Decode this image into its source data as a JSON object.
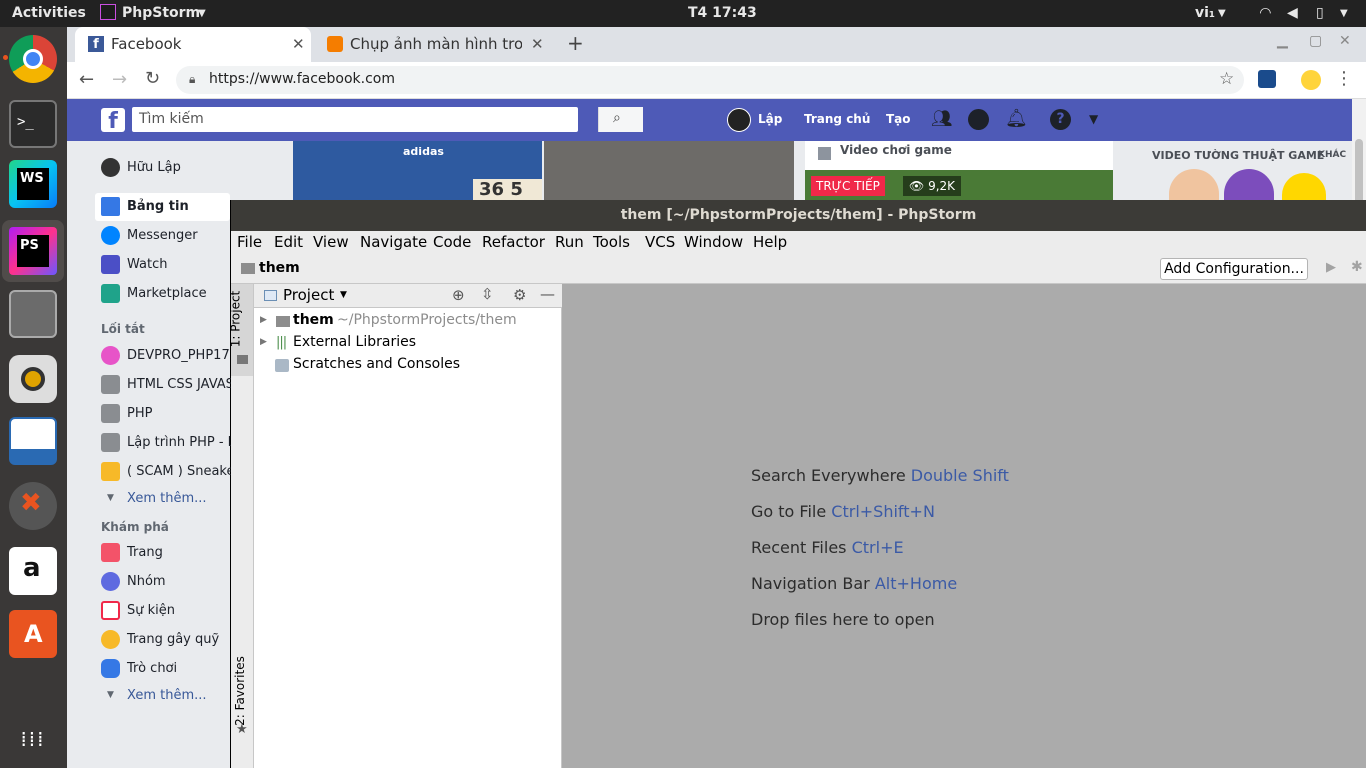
{
  "topbar": {
    "activities": "Activities",
    "app": "PhpStorm",
    "clock": "T4 17:43",
    "lang": "vi₁"
  },
  "browser": {
    "tabs": [
      {
        "title": "Facebook"
      },
      {
        "title": "Chụp ảnh màn hình trong"
      }
    ],
    "url": "https://www.facebook.com"
  },
  "facebook": {
    "search_placeholder": "Tìm kiếm",
    "nav": {
      "user": "Lập",
      "home": "Trang chủ",
      "create": "Tạo"
    },
    "sidebar": {
      "profile": "Hữu Lập",
      "news": "Bảng tin",
      "messenger": "Messenger",
      "watch": "Watch",
      "marketplace": "Marketplace",
      "shortcuts_title": "Lối tắt",
      "shortcuts": [
        "DEVPRO_PHP17",
        "HTML CSS JAVASCRIPT",
        "PHP",
        "Lập trình PHP - La",
        "( SCAM ) Sneaker"
      ],
      "see_more": "Xem thêm...",
      "explore_title": "Khám phá",
      "explore": [
        "Trang",
        "Nhóm",
        "Sự kiện",
        "Trang gây quỹ",
        "Trò chơi"
      ],
      "see_more2": "Xem thêm..."
    },
    "feed": {
      "box_text": "36 5",
      "brand": "adidas",
      "video_label": "Video chơi game",
      "live": "TRỰC TIẾP",
      "views": "9,2K",
      "right_title": "VIDEO TƯỜNG THUẬT GAME",
      "right_more": "KHÁC"
    }
  },
  "ide": {
    "title": "them [~/PhpstormProjects/them] - PhpStorm",
    "menu": [
      "File",
      "Edit",
      "View",
      "Navigate",
      "Code",
      "Refactor",
      "Run",
      "Tools",
      "VCS",
      "Window",
      "Help"
    ],
    "breadcrumb": "them",
    "add_config": "Add Configuration...",
    "stripe": {
      "project": "1: Project",
      "favorites": "2: Favorites"
    },
    "project_panel": {
      "title": "Project",
      "root_name": "them",
      "root_path": "~/PhpstormProjects/them",
      "ext_libs": "External Libraries",
      "scratches": "Scratches and Consoles"
    },
    "hints": [
      {
        "label": "Search Everywhere",
        "key": "Double Shift"
      },
      {
        "label": "Go to File",
        "key": "Ctrl+Shift+N"
      },
      {
        "label": "Recent Files",
        "key": "Ctrl+E"
      },
      {
        "label": "Navigation Bar",
        "key": "Alt+Home"
      },
      {
        "label": "Drop files here to open",
        "key": ""
      }
    ]
  }
}
